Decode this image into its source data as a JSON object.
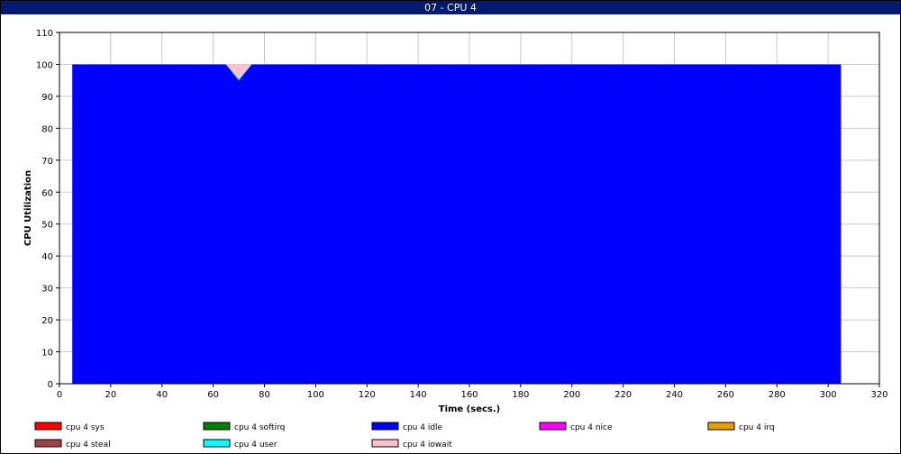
{
  "window": {
    "title": "07 - CPU 4"
  },
  "chart_data": {
    "type": "area",
    "title": "07 - CPU 4",
    "xlabel": "Time (secs.)",
    "ylabel": "CPU Utilization",
    "xlim": [
      0,
      320
    ],
    "ylim": [
      0,
      110
    ],
    "xticks": [
      0,
      20,
      40,
      60,
      80,
      100,
      120,
      140,
      160,
      180,
      200,
      220,
      240,
      260,
      280,
      300,
      320
    ],
    "yticks": [
      0,
      10,
      20,
      30,
      40,
      50,
      60,
      70,
      80,
      90,
      100,
      110
    ],
    "grid": true,
    "legend_position": "bottom",
    "x": [
      5,
      65,
      70,
      75,
      305
    ],
    "series": [
      {
        "name": "cpu 4 idle",
        "color": "#0000ff",
        "values": [
          100,
          100,
          95,
          100,
          100
        ]
      },
      {
        "name": "cpu 4 user",
        "color": "#00ffff",
        "values": [
          0,
          0,
          0.5,
          0,
          0
        ]
      },
      {
        "name": "cpu 4 sys",
        "color": "#ff0000",
        "values": [
          0,
          0,
          0,
          0,
          0
        ]
      },
      {
        "name": "cpu 4 softirq",
        "color": "#008000",
        "values": [
          0,
          0,
          0,
          0,
          0
        ]
      },
      {
        "name": "cpu 4 nice",
        "color": "#ff00ff",
        "values": [
          0,
          0,
          0,
          0,
          0
        ]
      },
      {
        "name": "cpu 4 irq",
        "color": "#e69f00",
        "values": [
          0,
          0,
          0,
          0,
          0
        ]
      },
      {
        "name": "cpu 4 steal",
        "color": "#a0404a",
        "values": [
          0,
          0,
          0,
          0,
          0
        ]
      },
      {
        "name": "cpu 4 iowait",
        "color": "#ffc0cb",
        "values": [
          0,
          0,
          4.5,
          0,
          0
        ]
      }
    ],
    "legend": [
      {
        "label": "cpu 4 sys",
        "color": "#ff0000"
      },
      {
        "label": "cpu 4 softirq",
        "color": "#008000"
      },
      {
        "label": "cpu 4 idle",
        "color": "#0000ff"
      },
      {
        "label": "cpu 4 nice",
        "color": "#ff00ff"
      },
      {
        "label": "cpu 4 irq",
        "color": "#e69f00"
      },
      {
        "label": "cpu 4 steal",
        "color": "#a0404a"
      },
      {
        "label": "cpu 4 user",
        "color": "#00ffff"
      },
      {
        "label": "cpu 4 iowait",
        "color": "#ffc0cb"
      }
    ]
  }
}
